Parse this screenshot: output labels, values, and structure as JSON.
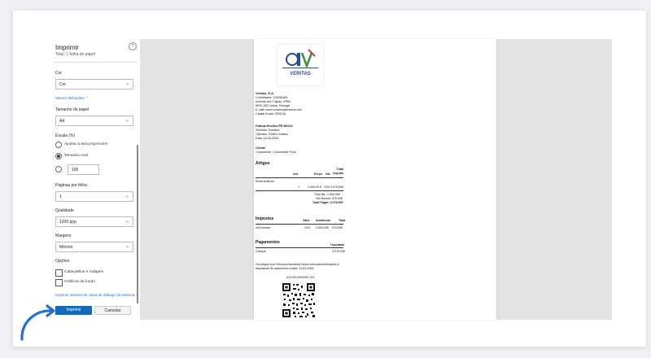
{
  "panel": {
    "title": "Imprimir",
    "subtitle": "Total: 1 folha de papel",
    "help": "?",
    "color_label": "Cor",
    "color_value": "Cor",
    "less_settings": "Menos definições ⌃",
    "paper_size_label": "Tamanho do papel",
    "paper_size_value": "A4",
    "scale_label": "Escala (%)",
    "scale_opt1": "Ajustar à área imprimível",
    "scale_opt2": "Tamanho real",
    "scale_custom_value": "100",
    "pages_per_sheet_label": "Páginas por folha",
    "pages_per_sheet_value": "1",
    "quality_label": "Qualidade",
    "quality_value": "1200 ppp",
    "margins_label": "Margens",
    "margins_value": "Mínimo",
    "options_label": "Opções",
    "opt_headers": "Cabeçalhos e rodapés",
    "opt_backgrounds": "Gráficos de fundo",
    "system_dialog_link": "Imprimir através de caixa de diálogo do sistema...",
    "print_button": "Imprimir",
    "cancel_button": "Cancelar"
  },
  "document": {
    "logo_text": "VERITAS",
    "company": "Veritas, S.A.",
    "contribuinte": "Contribuinte: 216256489",
    "address1": "Avenida dos Tulipas, nº962",
    "address2": "9000-150 Lisboa, Portugal",
    "email": "E-mail: ruben.crasino@crsoma.com",
    "capital": "Capital Social: 5000,00",
    "invoice_title": "Fatura-Recibo FR M/124",
    "terminal": "Terminal: Estúdios",
    "operator": "Operator: Ruben Crasino",
    "date": "Data: 14-04-2026",
    "client_label": "Cliente",
    "client_value": "Consumidor: Consumidor Final",
    "items_title": "Artigos",
    "col_un": "Uni.",
    "col_price": "Preço",
    "col_iva": "IVA",
    "col_total": "Total Líquido",
    "item_name": "Relva Artificial",
    "item_qty": "1",
    "item_price": "2.500,00 €",
    "item_iva": "23%",
    "item_total": "3.075,00€",
    "total_iliq": "Total Iliq.: 2.500,00€",
    "iva_normal": "IVA Normal: 575,00€",
    "total_pagar": "Total Pagar: 3.075,00€",
    "taxes_title": "Impostos",
    "tax_col_value": "Valor",
    "tax_col_incidence": "Incidência",
    "tax_col_total": "Total",
    "tax_name": "IVA Normal",
    "tax_rate": "23%",
    "tax_incidence": "2.500,00€",
    "tax_total": "575,00€",
    "payments_title": "Pagamentos",
    "pay_col": "Liquidado",
    "pay_method": "Cheque",
    "pay_value": "3.075,00€",
    "note1": "Os Artigos e/ou Serviços faturados foram colocados/efetuados à",
    "note2": "disposição do adquirente a data: 14-04-2026",
    "atcud": "ATCUD:0000000-124"
  }
}
